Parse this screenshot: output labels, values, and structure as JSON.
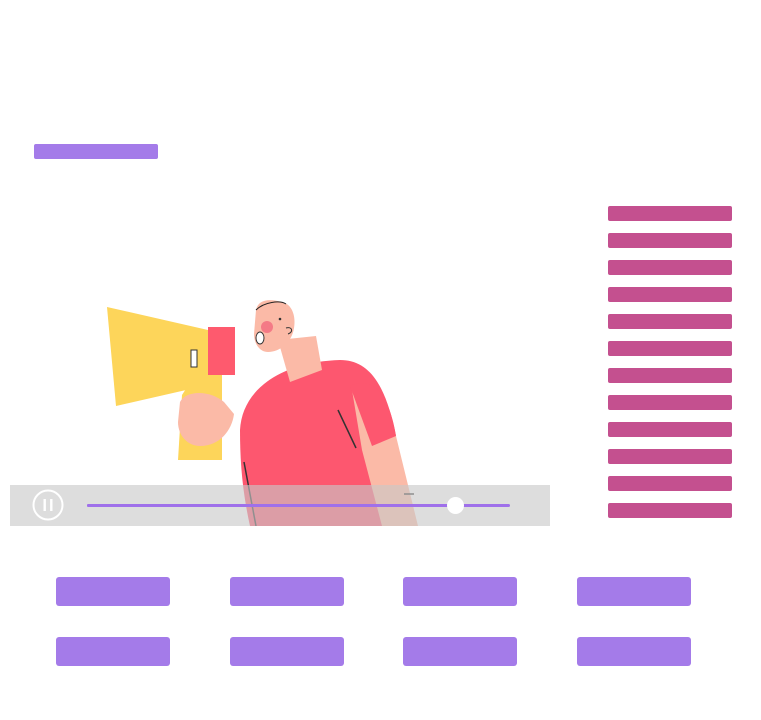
{
  "colors": {
    "accent_purple": "#a47be9",
    "playlist_magenta": "#c4508f",
    "controls_bg": "#d4d4d4",
    "progress_purple": "#9f70ea",
    "megaphone_yellow": "#fdd55a",
    "megaphone_red": "#fe5a6e",
    "shirt_red": "#fd576f",
    "skin": "#fbbaa7"
  },
  "header": {
    "title_placeholder": ""
  },
  "video": {
    "state": "playing",
    "control_icon": "pause-icon",
    "progress": 0.87
  },
  "playlist": {
    "items": [
      "",
      "",
      "",
      "",
      "",
      "",
      "",
      "",
      "",
      "",
      "",
      ""
    ]
  },
  "grid": {
    "buttons": [
      "",
      "",
      "",
      "",
      "",
      "",
      "",
      ""
    ]
  }
}
